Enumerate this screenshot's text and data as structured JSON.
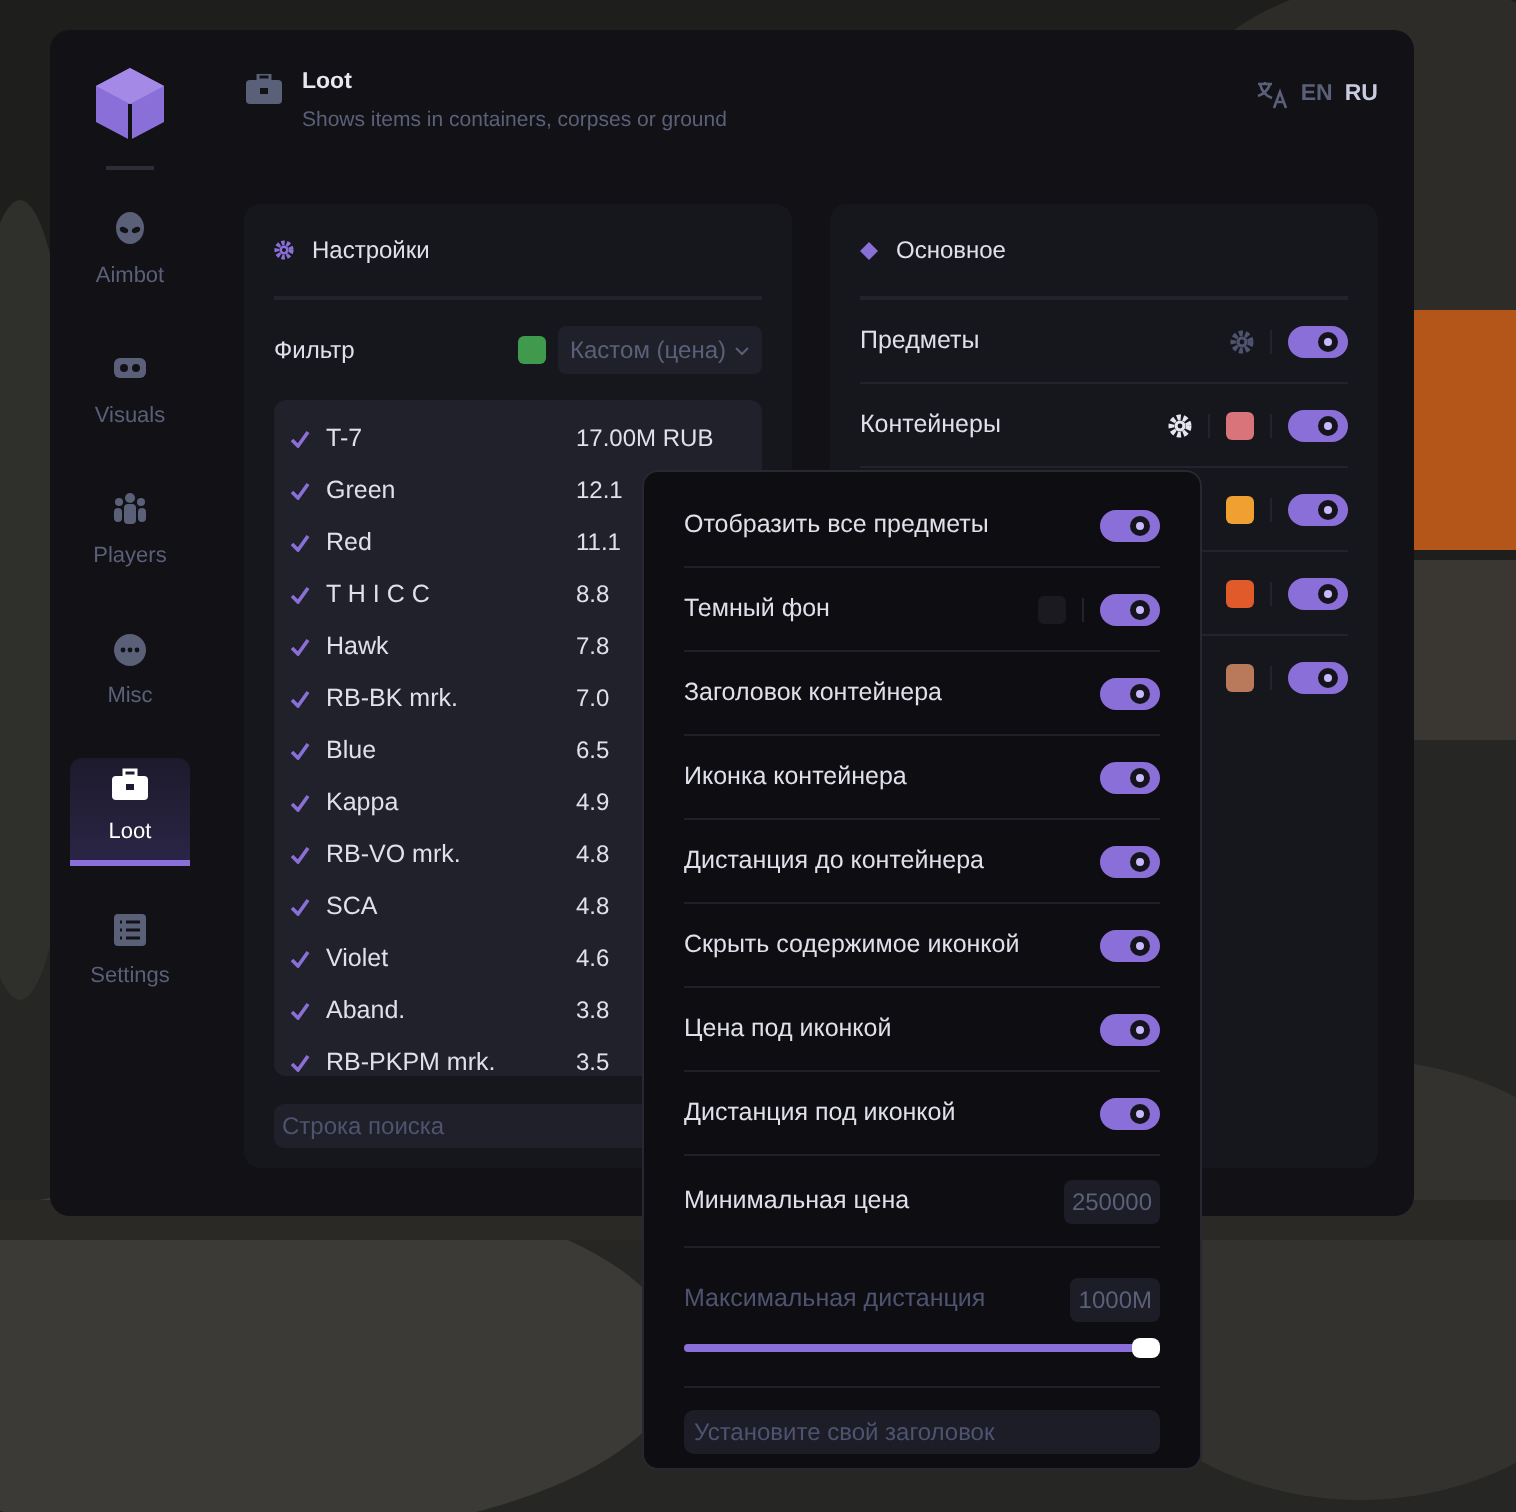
{
  "sidebar": {
    "items": [
      {
        "label": "Aimbot",
        "selected": false
      },
      {
        "label": "Visuals",
        "selected": false
      },
      {
        "label": "Players",
        "selected": false
      },
      {
        "label": "Misc",
        "selected": false
      },
      {
        "label": "Loot",
        "selected": true
      },
      {
        "label": "Settings",
        "selected": false
      }
    ]
  },
  "header": {
    "title": "Loot",
    "subtitle": "Shows items in containers, corpses or ground",
    "languages": [
      {
        "label": "EN",
        "selected": false
      },
      {
        "label": "RU",
        "selected": true
      }
    ]
  },
  "settings_panel": {
    "title": "Настройки",
    "filter": {
      "label": "Фильтр",
      "color": "#3f9a4e",
      "select": "Кастом (цена)"
    },
    "items": [
      {
        "name": "T-7",
        "checked": true,
        "value": "17.00M RUB"
      },
      {
        "name": "Green",
        "checked": true,
        "value": "12.1"
      },
      {
        "name": "Red",
        "checked": true,
        "value": "11.1"
      },
      {
        "name": "T H I C C",
        "checked": true,
        "value": "8.8"
      },
      {
        "name": "Hawk",
        "checked": true,
        "value": "7.8"
      },
      {
        "name": "RB-BK mrk.",
        "checked": true,
        "value": "7.0"
      },
      {
        "name": "Blue",
        "checked": true,
        "value": "6.5"
      },
      {
        "name": "Kappa",
        "checked": true,
        "value": "4.9"
      },
      {
        "name": "RB-VO mrk.",
        "checked": true,
        "value": "4.8"
      },
      {
        "name": "SCA",
        "checked": true,
        "value": "4.8"
      },
      {
        "name": "Violet",
        "checked": true,
        "value": "4.6"
      },
      {
        "name": "Aband.",
        "checked": true,
        "value": "3.8"
      },
      {
        "name": "RB-PKPM mrk.",
        "checked": true,
        "value": "3.5"
      }
    ],
    "search": {
      "placeholder": "Строка поиска"
    }
  },
  "main_panel": {
    "title": "Основное",
    "rows": [
      {
        "label": "Предметы",
        "settings_open": false,
        "on": true
      },
      {
        "label": "Контейнеры",
        "settings_open": true,
        "color": "#d9757a",
        "on": true
      },
      {
        "color": "#f0a030",
        "on": true
      },
      {
        "color": "#e05a2a",
        "on": true
      },
      {
        "color": "#b87a5a",
        "on": true
      }
    ]
  },
  "popup": {
    "rows": [
      {
        "kind": "toggle",
        "label": "Отобразить все предметы",
        "on": true
      },
      {
        "kind": "toggle",
        "label": "Темный фон",
        "color": "#1a1a20",
        "on": true
      },
      {
        "kind": "toggle",
        "label": "Заголовок контейнера",
        "on": true
      },
      {
        "kind": "toggle",
        "label": "Иконка контейнера",
        "on": true
      },
      {
        "kind": "toggle",
        "label": "Дистанция до контейнера",
        "on": true
      },
      {
        "kind": "toggle",
        "label": "Скрыть содержимое иконкой",
        "on": true
      },
      {
        "kind": "toggle",
        "label": "Цена под иконкой",
        "on": true
      },
      {
        "kind": "toggle",
        "label": "Дистанция под иконкой",
        "on": true
      },
      {
        "kind": "number",
        "label": "Минимальная цена",
        "value": "250000"
      },
      {
        "kind": "slider",
        "label": "Максимальная дистанция",
        "value": "1000M",
        "disabled": true,
        "level": 1
      },
      {
        "kind": "text",
        "placeholder": "Установите свой заголовок"
      }
    ]
  }
}
